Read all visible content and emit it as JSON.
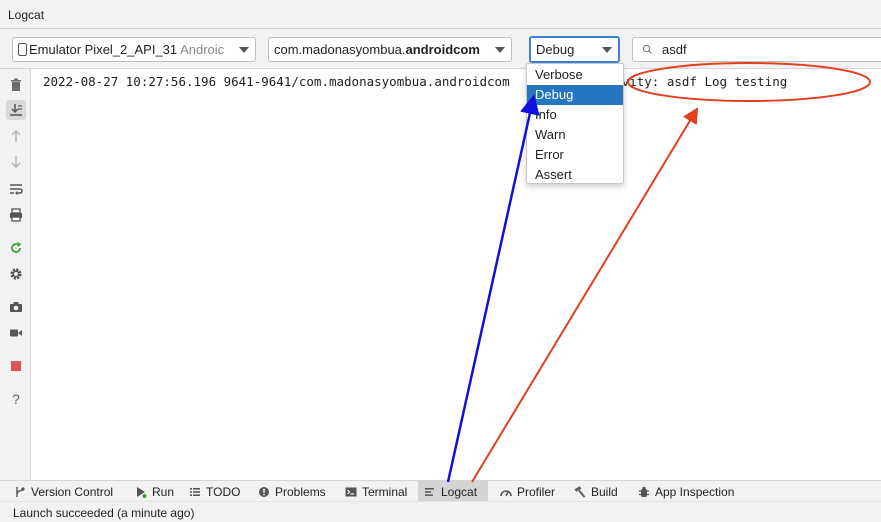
{
  "window": {
    "title": "Logcat"
  },
  "toolbar": {
    "device_name": "Emulator Pixel_2_API_31",
    "device_suffix": "Androic",
    "package_prefix": "com.madonasyombua.",
    "package_bold": "androidcom",
    "log_level": "Debug",
    "search_value": "asdf"
  },
  "log_level_menu": {
    "options": [
      "Verbose",
      "Debug",
      "Info",
      "Warn",
      "Error",
      "Assert"
    ],
    "selected": "Debug"
  },
  "log": {
    "line_part1": "2022-08-27 10:27:56.196 9641-9641/com.madonasyombua.androidcom",
    "line_part2": "Activity: asdf Log testing"
  },
  "left_tools": [
    "trash-icon",
    "scroll-to-end-icon",
    "up-arrow-icon",
    "down-arrow-icon",
    "soft-wrap-icon",
    "print-icon",
    "restart-icon",
    "gear-icon",
    "camera-icon",
    "video-icon",
    "stop-icon",
    "help-icon"
  ],
  "bottom_tabs": [
    {
      "label": "Version Control",
      "icon": "branch-icon"
    },
    {
      "label": "Run",
      "icon": "run-icon"
    },
    {
      "label": "TODO",
      "icon": "list-icon"
    },
    {
      "label": "Problems",
      "icon": "problems-icon"
    },
    {
      "label": "Terminal",
      "icon": "terminal-icon"
    },
    {
      "label": "Logcat",
      "icon": "logcat-icon",
      "active": true
    },
    {
      "label": "Profiler",
      "icon": "profiler-icon"
    },
    {
      "label": "Build",
      "icon": "hammer-icon"
    },
    {
      "label": "App Inspection",
      "icon": "inspection-icon"
    }
  ],
  "status": {
    "text": "Launch succeeded (a minute ago)"
  },
  "colors": {
    "selection_blue": "#2675bf",
    "focus_border": "#3b82d6",
    "annotation_blue_arrow": "#1010e0",
    "annotation_red_arrow": "#e2401c",
    "stop_red": "#d95555",
    "run_green": "#3aa43a"
  }
}
